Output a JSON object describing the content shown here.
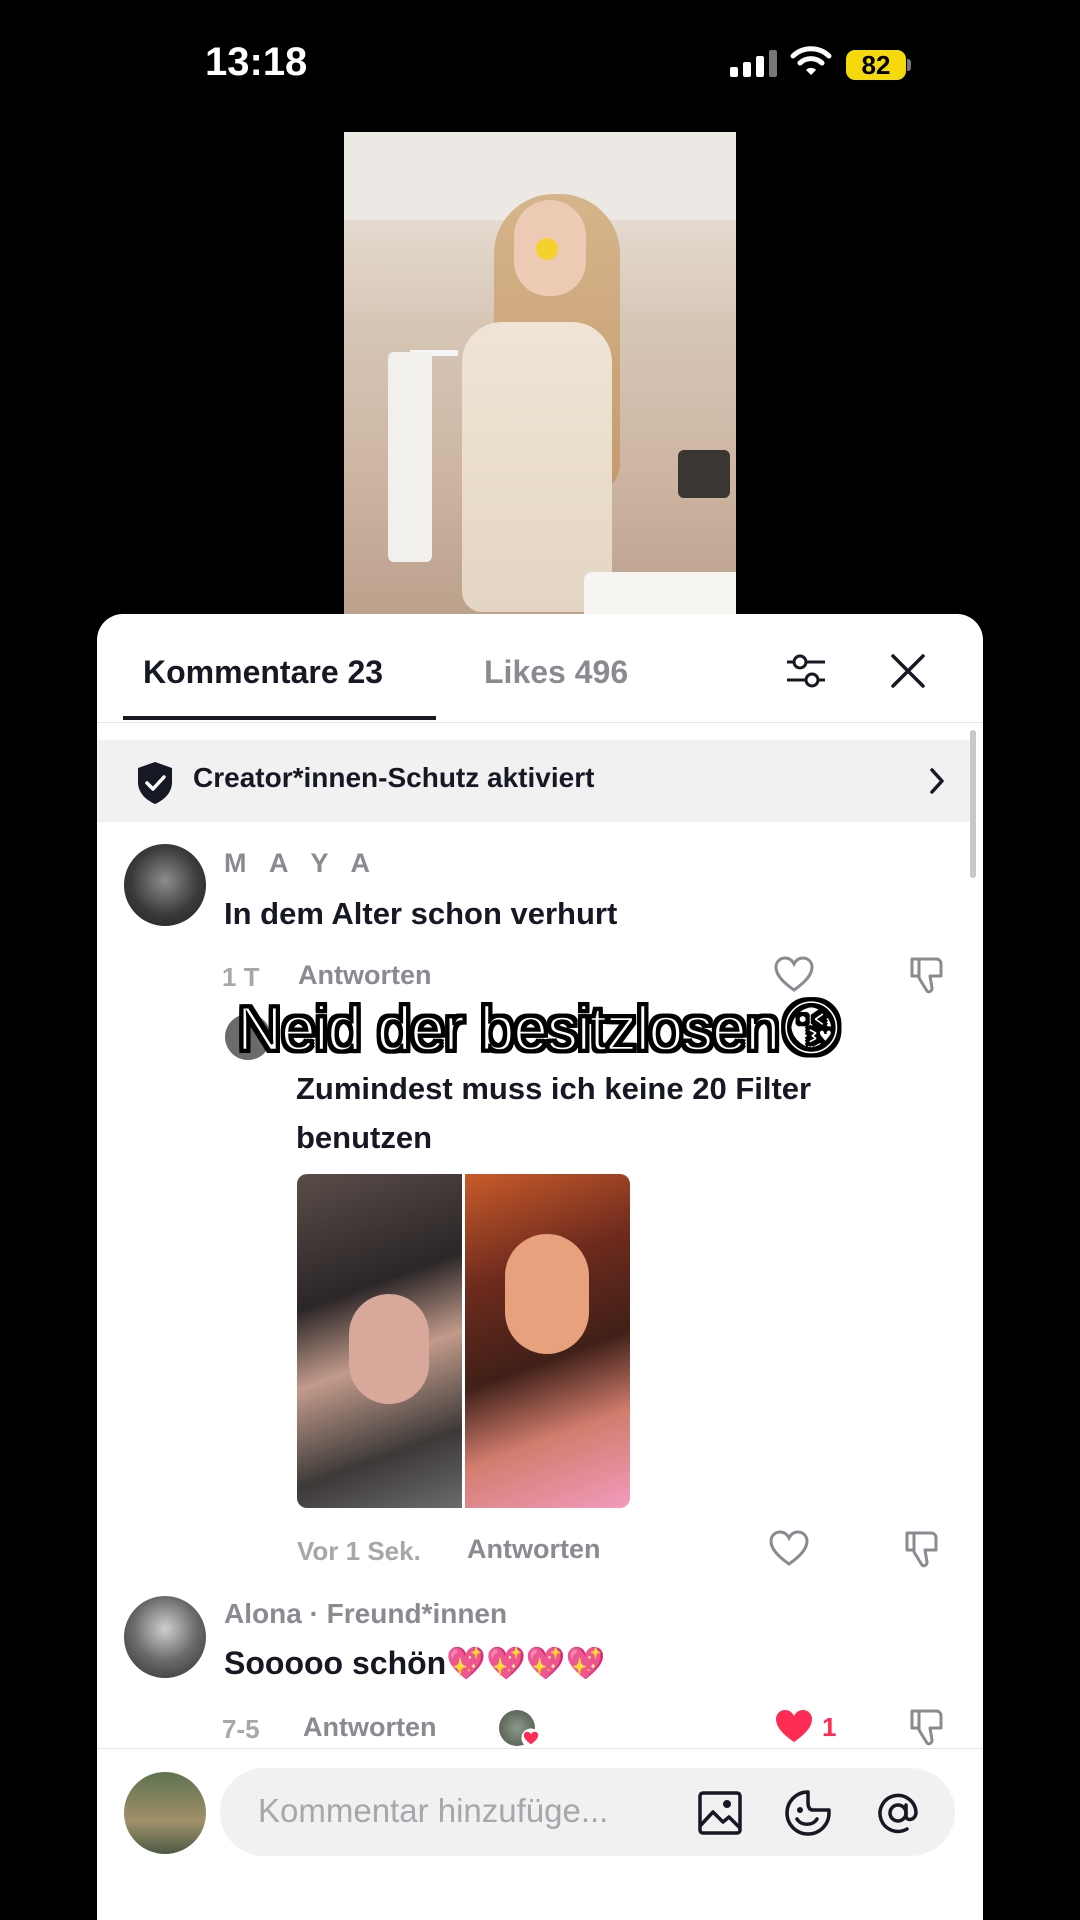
{
  "status_bar": {
    "time": "13:18",
    "battery": "82"
  },
  "video": {
    "overlay_caption": "Neid der besitzlosen😘"
  },
  "sheet": {
    "tabs": [
      {
        "label": "Kommentare 23",
        "active": true
      },
      {
        "label": "Likes 496",
        "active": false
      }
    ],
    "protection_banner": "Creator*innen-Schutz aktiviert",
    "comments": [
      {
        "username": "M A Y A",
        "text": "In dem Alter schon verhurt",
        "time": "1 T",
        "reply_label": "Antworten"
      },
      {
        "text": "Zumindest muss ich keine 20 Filter benutzen",
        "time": "Vor 1 Sek.",
        "reply_label": "Antworten",
        "has_images": true
      },
      {
        "username": "Alona · Freund*innen",
        "text": "Sooooo schön💖💖💖💖",
        "time": "7-5",
        "reply_label": "Antworten",
        "likes": "1",
        "liked": true
      }
    ],
    "input": {
      "placeholder": "Kommentar hinzufüge..."
    }
  },
  "colors": {
    "accent_like": "#fe2c55",
    "battery": "#f5d90a",
    "text_primary": "#161823",
    "text_secondary": "#8a8b91"
  },
  "icons": [
    "signal-icon",
    "wifi-icon",
    "battery-icon",
    "filter-icon",
    "close-icon",
    "shield-check-icon",
    "chevron-right-icon",
    "heart-icon",
    "dislike-icon",
    "image-icon",
    "emoji-icon",
    "mention-icon"
  ]
}
